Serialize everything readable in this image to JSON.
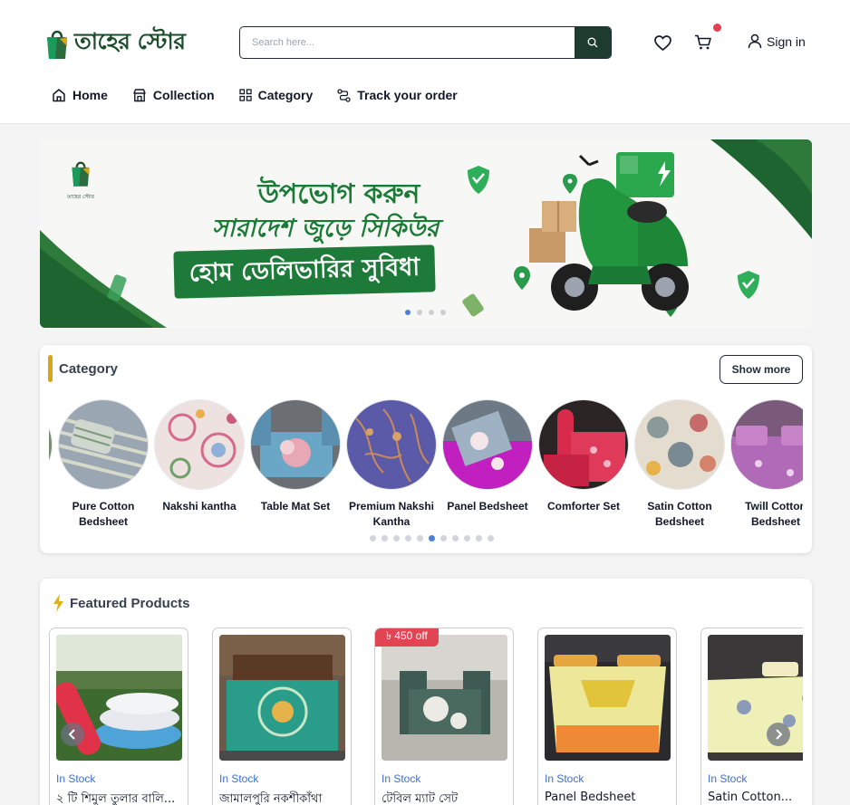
{
  "header": {
    "logo_text": "তাহের স্টোর",
    "search_placeholder": "Search here...",
    "sign_in_label": "Sign in",
    "cart_badge_color": "#e53e4f"
  },
  "nav": [
    {
      "label": "Home",
      "icon": "home-icon"
    },
    {
      "label": "Collection",
      "icon": "store-icon"
    },
    {
      "label": "Category",
      "icon": "grid-icon"
    },
    {
      "label": "Track your order",
      "icon": "route-icon"
    }
  ],
  "banner": {
    "logo_caption": "তাহের স্টোর",
    "line1": "উপভোগ করুন",
    "line2": "সারাদেশ জুড়ে সিকিউর",
    "line3": "হোম ডেলিভারির সুবিধা",
    "slide_count": 4,
    "active_slide": 1
  },
  "category_section": {
    "title": "Category",
    "show_more_label": "Show more",
    "items": [
      {
        "label": "Pure Cotton Bedsheet"
      },
      {
        "label": "Nakshi kantha"
      },
      {
        "label": "Table Mat Set"
      },
      {
        "label": "Premium Nakshi Kantha"
      },
      {
        "label": "Panel Bedsheet"
      },
      {
        "label": "Comforter Set"
      },
      {
        "label": "Satin Cotton Bedsheet"
      },
      {
        "label": "Twill Cotton Bedsheet"
      }
    ],
    "dot_count": 11,
    "active_dot": 5
  },
  "featured_section": {
    "title": "Featured Products",
    "products": [
      {
        "stock": "In Stock",
        "name": "২ টি শিমুল তুলার বালি...",
        "discount": ""
      },
      {
        "stock": "In Stock",
        "name": "জামালপুরি নকশীকাঁথা",
        "discount": ""
      },
      {
        "stock": "In Stock",
        "name": "টেবিল ম্যাট সেট",
        "discount": "৳ 450 off"
      },
      {
        "stock": "In Stock",
        "name": "Panel Bedsheet",
        "discount": ""
      },
      {
        "stock": "In Stock",
        "name": "Satin Cotton...",
        "discount": ""
      }
    ]
  },
  "colors": {
    "brand_dark": "#1d3b2f",
    "brand_green": "#1a7a36",
    "accent_gold": "#d9a514",
    "stock_blue": "#3b6fd4",
    "discount_red": "#e14452"
  }
}
